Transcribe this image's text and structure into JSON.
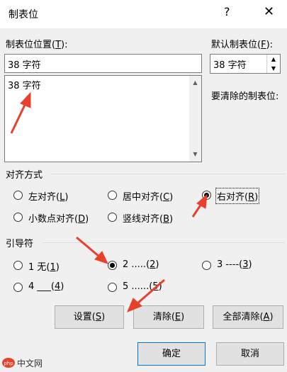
{
  "dialog": {
    "title": "制表位",
    "help": "?",
    "close": "✕"
  },
  "tab_position": {
    "label_prefix": "制表位位置(",
    "label_key": "T",
    "label_suffix": "):",
    "value": "38 字符",
    "list_items": [
      "38 字符"
    ]
  },
  "default_stop": {
    "label_prefix": "默认制表位(",
    "label_key": "F",
    "label_suffix": "):",
    "value": "38 字符"
  },
  "to_clear_label": "要清除的制表位:",
  "alignment": {
    "label": "对齐方式",
    "options": [
      {
        "text": "左对齐(",
        "key": "L",
        "end": ")",
        "checked": false
      },
      {
        "text": "居中对齐(",
        "key": "C",
        "end": ")",
        "checked": false
      },
      {
        "text": "右对齐(",
        "key": "R",
        "end": ")",
        "checked": true
      },
      {
        "text": "小数点对齐(",
        "key": "D",
        "end": ")",
        "checked": false
      },
      {
        "text": "竖线对齐(",
        "key": "B",
        "end": ")",
        "checked": false
      }
    ]
  },
  "leader": {
    "label": "引导符",
    "options": [
      {
        "text": "1 无(",
        "key": "1",
        "end": ")",
        "checked": false
      },
      {
        "text": "2 .....(",
        "key": "2",
        "end": ")",
        "checked": true
      },
      {
        "text": "3 ----(",
        "key": "3",
        "end": ")",
        "checked": false
      },
      {
        "text": "4 ___(",
        "key": "4",
        "end": ")",
        "checked": false
      },
      {
        "text": "5 ......(",
        "key": "5",
        "end": ")",
        "checked": false
      }
    ]
  },
  "buttons": {
    "set": {
      "text": "设置(",
      "key": "S",
      "end": ")"
    },
    "clear": {
      "text": "清除(",
      "key": "E",
      "end": ")"
    },
    "clear_all": {
      "text": "全部清除(",
      "key": "A",
      "end": ")"
    },
    "ok": "确定",
    "cancel": "取消"
  },
  "watermark": "中文网",
  "colors": {
    "accent": "#0078d7",
    "arrow": "#e8402a"
  }
}
